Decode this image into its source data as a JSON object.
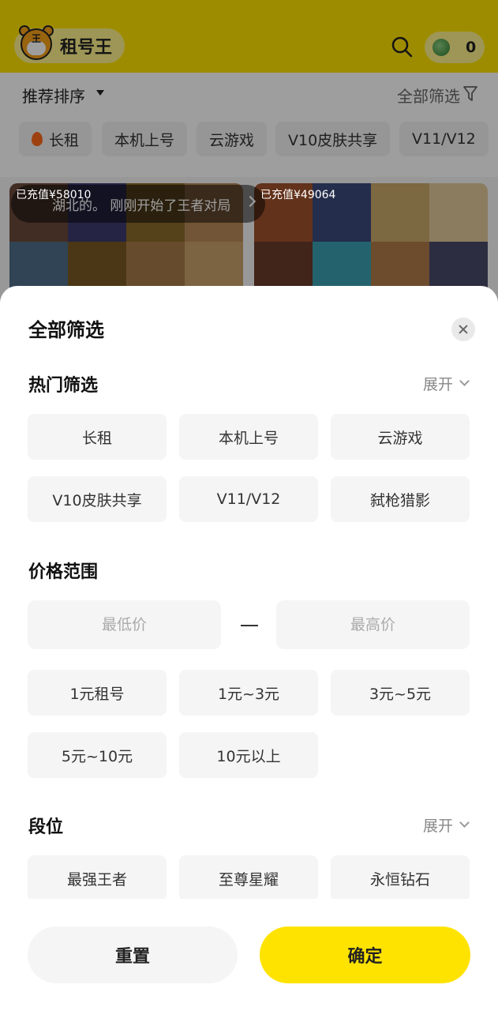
{
  "header": {
    "app_name": "租号王",
    "logo_mark": "王",
    "coin_count": "0",
    "brand_color": "#ffe300"
  },
  "sort_bar": {
    "sort_label": "推荐排序",
    "filter_label": "全部筛选"
  },
  "quick_tags": [
    "长租",
    "本机上号",
    "云游戏",
    "V10皮肤共享",
    "V11/V12"
  ],
  "cards": [
    {
      "charge": "已充值¥58010"
    },
    {
      "charge": "已充值¥49064"
    }
  ],
  "toast": {
    "text": "湖北的。 刚刚开始了王者对局"
  },
  "sheet": {
    "title": "全部筛选",
    "hot": {
      "title": "热门筛选",
      "expand": "展开",
      "options": [
        "长租",
        "本机上号",
        "云游戏",
        "V10皮肤共享",
        "V11/V12",
        "弑枪猎影"
      ]
    },
    "price": {
      "title": "价格范围",
      "min_placeholder": "最低价",
      "max_placeholder": "最高价",
      "options": [
        "1元租号",
        "1元~3元",
        "3元~5元",
        "5元~10元",
        "10元以上"
      ]
    },
    "rank": {
      "title": "段位",
      "expand": "展开",
      "options": [
        "最强王者",
        "至尊星耀",
        "永恒钻石"
      ]
    },
    "reset_label": "重置",
    "confirm_label": "确定"
  },
  "icons": [
    "tiger-logo-icon",
    "search-icon",
    "coin-icon",
    "caret-down-icon",
    "filter-icon",
    "fire-icon",
    "chevron-right-icon",
    "close-icon",
    "chevron-down-icon"
  ]
}
